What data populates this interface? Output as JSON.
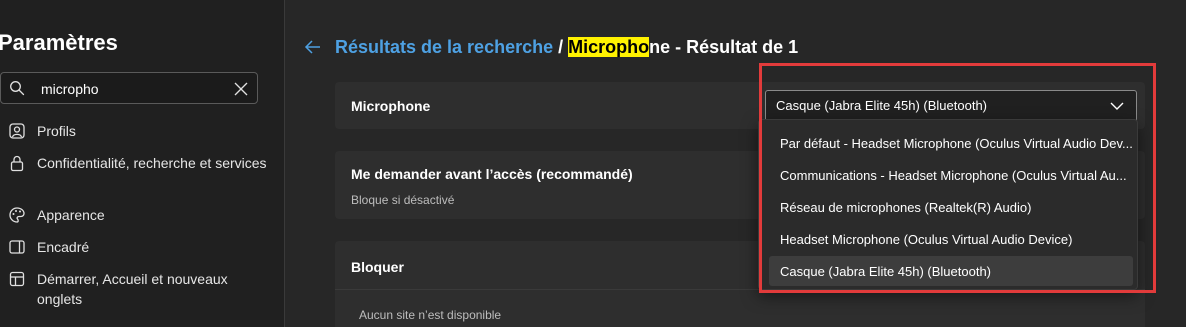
{
  "sidebar": {
    "title": "Paramètres",
    "search": {
      "value": "micropho",
      "placeholder": ""
    },
    "items": [
      {
        "label": "Profils",
        "icon": "profile-icon"
      },
      {
        "label": "Confidentialité, recherche et services",
        "icon": "lock-icon"
      },
      {
        "label": "Apparence",
        "icon": "palette-icon"
      },
      {
        "label": "Encadré",
        "icon": "sidebar-panel-icon"
      },
      {
        "label": "Démarrer, Accueil et nouveaux onglets",
        "icon": "home-icon"
      }
    ]
  },
  "header": {
    "link": "Résultats de la recherche",
    "separator": "/",
    "highlight": "Micropho",
    "rest": "ne - Résultat de 1"
  },
  "microphone_card": {
    "title": "Microphone",
    "selected_value": "Casque (Jabra Elite 45h) (Bluetooth)",
    "options": [
      "Par défaut - Headset Microphone (Oculus Virtual Audio Device)",
      "Communications - Headset Microphone (Oculus Virtual Audio Device)",
      "Réseau de microphones (Realtek(R) Audio)",
      "Headset Microphone (Oculus Virtual Audio Device)",
      "Casque (Jabra Elite 45h) (Bluetooth)"
    ],
    "selected_index": 4
  },
  "ask_card": {
    "title": "Me demander avant l’accès (recommandé)",
    "subtitle": "Bloque si désactivé"
  },
  "block_card": {
    "title": "Bloquer",
    "empty_text": "Aucun site n’est disponible"
  },
  "colors": {
    "accent": "#4ea1e3",
    "highlight": "#fff200",
    "annotation": "#e23b3b",
    "background": "#272727",
    "sidebar": "#202020",
    "card": "#2e2e2e"
  }
}
